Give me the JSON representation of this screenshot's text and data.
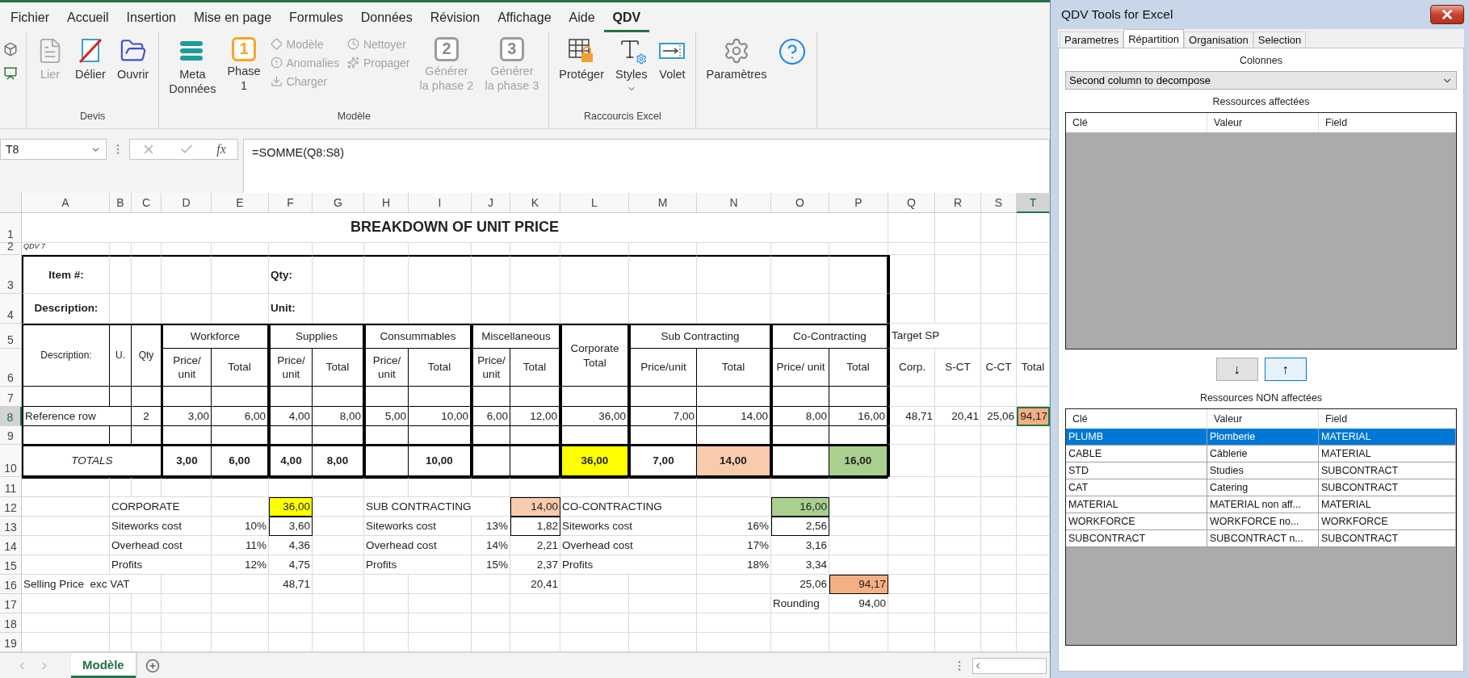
{
  "ribbon_tabs": [
    {
      "label": "Fichier",
      "selected": false
    },
    {
      "label": "Accueil",
      "selected": false
    },
    {
      "label": "Insertion",
      "selected": false
    },
    {
      "label": "Mise en page",
      "selected": false
    },
    {
      "label": "Formules",
      "selected": false
    },
    {
      "label": "Données",
      "selected": false
    },
    {
      "label": "Révision",
      "selected": false
    },
    {
      "label": "Affichage",
      "selected": false
    },
    {
      "label": "Aide",
      "selected": false
    },
    {
      "label": "QDV",
      "selected": true
    }
  ],
  "ribbon_groups": [
    {
      "label": "Devis",
      "items": [
        {
          "kind": "large",
          "lines": [
            "Lier"
          ],
          "disabled": true
        },
        {
          "kind": "large",
          "lines": [
            "Délier"
          ],
          "disabled": false
        },
        {
          "kind": "large",
          "lines": [
            "Ouvrir"
          ],
          "disabled": false
        }
      ]
    },
    {
      "label": "Modèle",
      "items": [
        {
          "kind": "large",
          "lines": [
            "Meta",
            "Données"
          ],
          "disabled": false
        },
        {
          "kind": "badge",
          "badge": "1",
          "lines": [
            "Phase",
            "1"
          ],
          "disabled": false
        },
        {
          "kind": "stack",
          "entries": [
            {
              "label": "Modèle",
              "disabled": true
            },
            {
              "label": "Anomalies",
              "disabled": true
            },
            {
              "label": "Charger",
              "disabled": true
            }
          ]
        },
        {
          "kind": "stack",
          "entries": [
            {
              "label": "Nettoyer",
              "disabled": true
            },
            {
              "label": "Propager",
              "disabled": true
            }
          ]
        },
        {
          "kind": "badge",
          "badge": "2",
          "lines": [
            "Générer",
            "la phase 2"
          ],
          "disabled": true
        },
        {
          "kind": "badge",
          "badge": "3",
          "lines": [
            "Générer",
            "la phase 3"
          ],
          "disabled": true
        }
      ]
    },
    {
      "label": "Raccourcis Excel",
      "items": [
        {
          "kind": "large",
          "lines": [
            "Protéger"
          ],
          "disabled": false
        },
        {
          "kind": "large",
          "lines": [
            "Styles"
          ],
          "disabled": false,
          "dropdown": true
        },
        {
          "kind": "large",
          "lines": [
            "Volet"
          ],
          "disabled": false
        }
      ]
    },
    {
      "items": [
        {
          "kind": "large",
          "lines": [
            "Paramètres"
          ],
          "disabled": false
        },
        {
          "kind": "icon",
          "disabled": false
        }
      ]
    }
  ],
  "formula_bar": {
    "name_box": "T8",
    "fx": "fx",
    "formula": "=SOMME(Q8:S8)"
  },
  "sheet": {
    "columns": [
      {
        "label": "A",
        "selected": false
      },
      {
        "label": "B",
        "selected": false
      },
      {
        "label": "C",
        "selected": false
      },
      {
        "label": "D",
        "selected": false
      },
      {
        "label": "E",
        "selected": false
      },
      {
        "label": "F",
        "selected": false
      },
      {
        "label": "G",
        "selected": false
      },
      {
        "label": "H",
        "selected": false
      },
      {
        "label": "I",
        "selected": false
      },
      {
        "label": "J",
        "selected": false
      },
      {
        "label": "K",
        "selected": false
      },
      {
        "label": "L",
        "selected": false
      },
      {
        "label": "M",
        "selected": false
      },
      {
        "label": "N",
        "selected": false
      },
      {
        "label": "O",
        "selected": false
      },
      {
        "label": "P",
        "selected": false
      },
      {
        "label": "Q",
        "selected": false
      },
      {
        "label": "R",
        "selected": false
      },
      {
        "label": "S",
        "selected": false
      },
      {
        "label": "T",
        "selected": true
      }
    ],
    "rows": [
      {
        "label": "1",
        "selected": false,
        "cells": [
          {
            "text": "BREAKDOWN OF UNIT PRICE",
            "kind": "title"
          }
        ]
      },
      {
        "label": "2",
        "selected": false,
        "cells": [
          {
            "text": "QDV 7",
            "kind": "note"
          }
        ]
      },
      {
        "label": "3",
        "selected": false,
        "cells": [
          {
            "text": "Item #:",
            "kind": "label-center"
          },
          {
            "text": "Qty:",
            "kind": "label"
          }
        ]
      },
      {
        "label": "4",
        "selected": false,
        "cells": [
          {
            "text": "Description:",
            "kind": "label-center"
          },
          {
            "text": "Unit:",
            "kind": "label"
          }
        ]
      },
      {
        "label": "5",
        "selected": false,
        "cells": [
          {
            "text": "Description:",
            "kind": "head-small"
          },
          {
            "text": "U.",
            "kind": "head-small"
          },
          {
            "text": "Qty",
            "kind": "head-small"
          },
          {
            "text": "Workforce",
            "kind": "head"
          },
          {
            "text": "Supplies",
            "kind": "head"
          },
          {
            "text": "Consummables",
            "kind": "head"
          },
          {
            "text": "Miscellaneous",
            "kind": "head"
          },
          {
            "text": "Corporate Total",
            "kind": "head"
          },
          {
            "text": "Sub Contracting",
            "kind": "head"
          },
          {
            "text": "Co-Contracting",
            "kind": "head"
          },
          {
            "text": "Target SP",
            "kind": "text"
          }
        ]
      },
      {
        "label": "6",
        "selected": false,
        "cells": [
          {
            "text": "Price/ unit",
            "kind": "head"
          },
          {
            "text": "Total",
            "kind": "head"
          },
          {
            "text": "Price/ unit",
            "kind": "head"
          },
          {
            "text": "Total",
            "kind": "head"
          },
          {
            "text": "Price/ unit",
            "kind": "head"
          },
          {
            "text": "Total",
            "kind": "head"
          },
          {
            "text": "Price/ unit",
            "kind": "head"
          },
          {
            "text": "Total",
            "kind": "head"
          },
          {
            "text": "Price/unit",
            "kind": "head"
          },
          {
            "text": "Total",
            "kind": "head"
          },
          {
            "text": "Price/ unit",
            "kind": "head"
          },
          {
            "text": "Total",
            "kind": "head"
          },
          {
            "text": "Corp.",
            "kind": "head"
          },
          {
            "text": "S-CT",
            "kind": "head"
          },
          {
            "text": "C-CT",
            "kind": "head"
          },
          {
            "text": "Total",
            "kind": "head"
          }
        ]
      },
      {
        "label": "7",
        "selected": false
      },
      {
        "label": "8",
        "selected": true,
        "cells": [
          {
            "text": "Reference row",
            "kind": "text"
          },
          {
            "text": "2",
            "kind": "center"
          },
          {
            "text": "3,00",
            "kind": "num"
          },
          {
            "text": "6,00",
            "kind": "num"
          },
          {
            "text": "4,00",
            "kind": "num"
          },
          {
            "text": "8,00",
            "kind": "num"
          },
          {
            "text": "5,00",
            "kind": "num"
          },
          {
            "text": "10,00",
            "kind": "num"
          },
          {
            "text": "6,00",
            "kind": "num"
          },
          {
            "text": "12,00",
            "kind": "num"
          },
          {
            "text": "36,00",
            "kind": "num"
          },
          {
            "text": "7,00",
            "kind": "num"
          },
          {
            "text": "14,00",
            "kind": "num"
          },
          {
            "text": "8,00",
            "kind": "num"
          },
          {
            "text": "16,00",
            "kind": "num"
          },
          {
            "text": "48,71",
            "kind": "num"
          },
          {
            "text": "20,41",
            "kind": "num"
          },
          {
            "text": "25,06",
            "kind": "num"
          },
          {
            "text": "94,17",
            "kind": "num",
            "color": "#f4b084"
          }
        ]
      },
      {
        "label": "9",
        "selected": false
      },
      {
        "label": "10",
        "selected": false,
        "cells": [
          {
            "text": "TOTALS",
            "kind": "total-label"
          },
          {
            "text": "3,00",
            "kind": "total"
          },
          {
            "text": "6,00",
            "kind": "total"
          },
          {
            "text": "4,00",
            "kind": "total"
          },
          {
            "text": "8,00",
            "kind": "total"
          },
          {
            "text": "10,00",
            "kind": "total"
          },
          {
            "text": "36,00",
            "kind": "total",
            "color": "#ffff00"
          },
          {
            "text": "7,00",
            "kind": "total"
          },
          {
            "text": "14,00",
            "kind": "total",
            "color": "#f8cbad"
          },
          {
            "text": "16,00",
            "kind": "total",
            "color": "#a9d08e"
          }
        ]
      },
      {
        "label": "11",
        "selected": false
      },
      {
        "label": "12",
        "selected": false,
        "cells": [
          {
            "text": "CORPORATE",
            "kind": "text"
          },
          {
            "text": "36,00",
            "kind": "boxed",
            "color": "#ffff00"
          },
          {
            "text": "SUB CONTRACTING",
            "kind": "text"
          },
          {
            "text": "14,00",
            "kind": "boxed",
            "color": "#f8cbad"
          },
          {
            "text": "CO-CONTRACTING",
            "kind": "text"
          },
          {
            "text": "16,00",
            "kind": "boxed",
            "color": "#a9d08e"
          }
        ]
      },
      {
        "label": "13",
        "selected": false,
        "cells": [
          {
            "text": "Siteworks cost",
            "kind": "text"
          },
          {
            "text": "10%",
            "kind": "num"
          },
          {
            "text": "3,60",
            "kind": "boxed"
          },
          {
            "text": "Siteworks cost",
            "kind": "text"
          },
          {
            "text": "13%",
            "kind": "num"
          },
          {
            "text": "1,82",
            "kind": "boxed"
          },
          {
            "text": "Siteworks cost",
            "kind": "text"
          },
          {
            "text": "16%",
            "kind": "num"
          },
          {
            "text": "2,56",
            "kind": "boxed"
          }
        ]
      },
      {
        "label": "14",
        "selected": false,
        "cells": [
          {
            "text": "Overhead cost",
            "kind": "text"
          },
          {
            "text": "11%",
            "kind": "num"
          },
          {
            "text": "4,36",
            "kind": "num"
          },
          {
            "text": "Overhead cost",
            "kind": "text"
          },
          {
            "text": "14%",
            "kind": "num"
          },
          {
            "text": "2,21",
            "kind": "num"
          },
          {
            "text": "Overhead cost",
            "kind": "text"
          },
          {
            "text": "17%",
            "kind": "num"
          },
          {
            "text": "3,16",
            "kind": "num"
          }
        ]
      },
      {
        "label": "15",
        "selected": false,
        "cells": [
          {
            "text": "Profits",
            "kind": "text"
          },
          {
            "text": "12%",
            "kind": "num"
          },
          {
            "text": "4,75",
            "kind": "num"
          },
          {
            "text": "Profits",
            "kind": "text"
          },
          {
            "text": "15%",
            "kind": "num"
          },
          {
            "text": "2,37",
            "kind": "num"
          },
          {
            "text": "Profits",
            "kind": "text"
          },
          {
            "text": "18%",
            "kind": "num"
          },
          {
            "text": "3,34",
            "kind": "num"
          }
        ]
      },
      {
        "label": "16",
        "selected": false,
        "cells": [
          {
            "text": "Selling Price  exc VAT",
            "kind": "text"
          },
          {
            "text": "48,71",
            "kind": "num"
          },
          {
            "text": "20,41",
            "kind": "num"
          },
          {
            "text": "25,06",
            "kind": "num"
          },
          {
            "text": "94,17",
            "kind": "boxed",
            "color": "#f4b084"
          }
        ]
      },
      {
        "label": "17",
        "selected": false,
        "cells": [
          {
            "text": "Rounding",
            "kind": "text"
          },
          {
            "text": "94,00",
            "kind": "num"
          }
        ]
      },
      {
        "label": "18",
        "selected": false
      },
      {
        "label": "19",
        "selected": false
      }
    ]
  },
  "sheet_tabs": [
    {
      "label": "Modèle",
      "selected": true
    }
  ],
  "panel": {
    "title": "QDV Tools for Excel",
    "tabs": [
      {
        "label": "Parametres",
        "selected": false
      },
      {
        "label": "Répartition",
        "selected": true
      },
      {
        "label": "Organisation",
        "selected": false
      },
      {
        "label": "Selection",
        "selected": false
      }
    ],
    "columns_label": "Colonnes",
    "column_select": "Second column to decompose",
    "assigned": {
      "title": "Ressources affectées",
      "headers": [
        "Clé",
        "Valeur",
        "Field"
      ]
    },
    "move_buttons": [
      {
        "label": "↓",
        "focused": false
      },
      {
        "label": "↑",
        "focused": true
      }
    ],
    "unassigned": {
      "title": "Ressources NON affectées",
      "headers": [
        "Clé",
        "Valeur",
        "Field"
      ],
      "rows": [
        {
          "cells": [
            "PLUMB",
            "Plomberie",
            "MATERIAL"
          ],
          "selected": true
        },
        {
          "cells": [
            "CABLE",
            "Câblerie",
            "MATERIAL"
          ],
          "selected": false
        },
        {
          "cells": [
            "STD",
            "Studies",
            "SUBCONTRACT"
          ],
          "selected": false
        },
        {
          "cells": [
            "CAT",
            "Catering",
            "SUBCONTRACT"
          ],
          "selected": false
        },
        {
          "cells": [
            "MATERIAL",
            "MATERIAL non aff...",
            "MATERIAL"
          ],
          "selected": false
        },
        {
          "cells": [
            "WORKFORCE",
            "WORKFORCE no...",
            "WORKFORCE"
          ],
          "selected": false
        },
        {
          "cells": [
            "SUBCONTRACT",
            "SUBCONTRACT n...",
            "SUBCONTRACT"
          ],
          "selected": false
        }
      ]
    }
  }
}
